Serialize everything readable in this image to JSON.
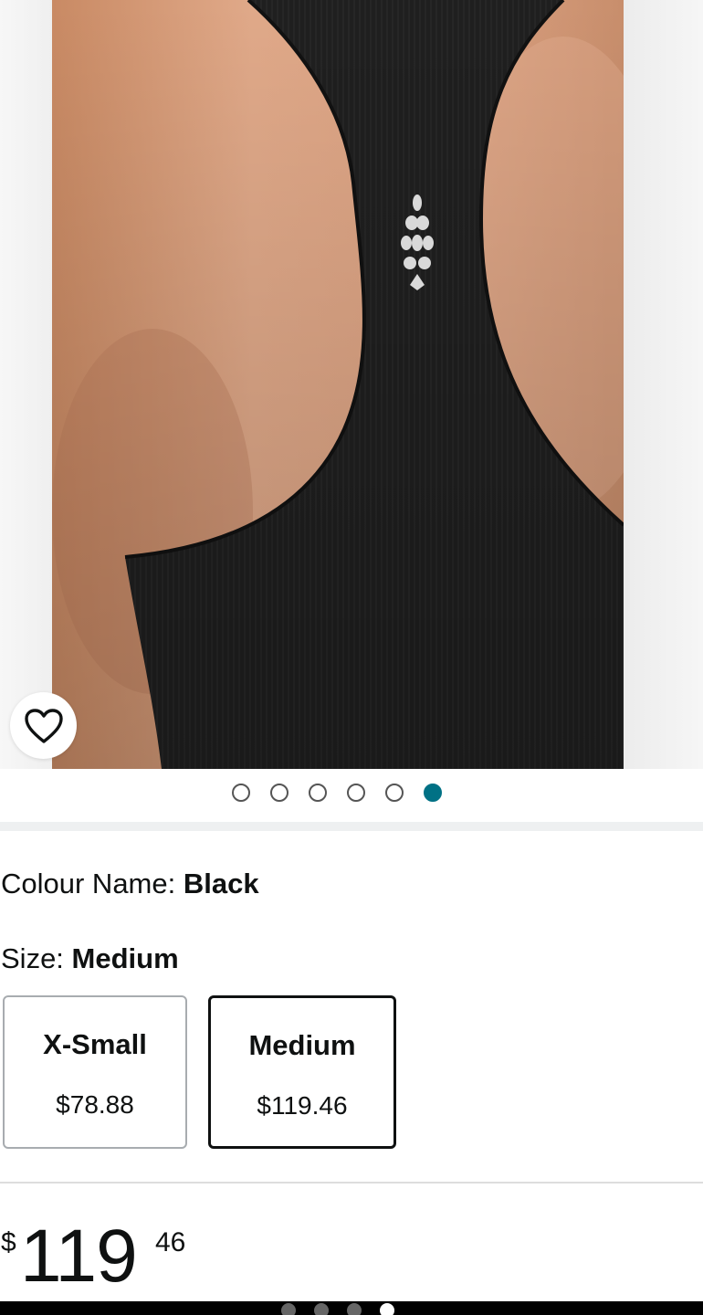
{
  "gallery": {
    "image_alt": "Black ribbed racerback tank top, back view",
    "wishlist_icon": "heart-outline-icon",
    "dots_total": 6,
    "dots_active_index": 5,
    "accent_color": "#007185"
  },
  "colour": {
    "label": "Colour Name: ",
    "value": "Black"
  },
  "size": {
    "label": "Size: ",
    "value": "Medium",
    "options": [
      {
        "name": "X-Small",
        "price": "$78.88",
        "selected": false
      },
      {
        "name": "Medium",
        "price": "$119.46",
        "selected": true
      }
    ]
  },
  "price": {
    "symbol": "$",
    "whole": "119",
    "fraction": "46"
  },
  "system_nav": {
    "indicator_count": 4,
    "indicator_active_index": 3
  }
}
